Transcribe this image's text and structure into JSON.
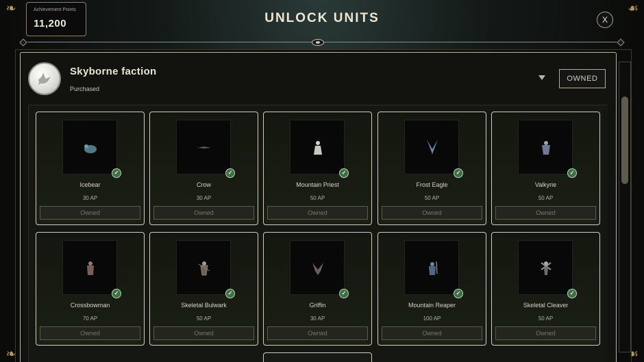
{
  "header": {
    "title": "UNLOCK UNITS",
    "close_label": "X",
    "achievement_points_label": "Achievement Points",
    "achievement_points_value": "11,200"
  },
  "faction": {
    "name": "Skyborne faction",
    "status": "Purchased",
    "owned_button": "OWNED",
    "emblem_icon": "dove-icon"
  },
  "units": [
    {
      "name": "Icebear",
      "cost": "30 AP",
      "button": "Owned"
    },
    {
      "name": "Crow",
      "cost": "30 AP",
      "button": "Owned"
    },
    {
      "name": "Mountain Priest",
      "cost": "50 AP",
      "button": "Owned"
    },
    {
      "name": "Frost Eagle",
      "cost": "50 AP",
      "button": "Owned"
    },
    {
      "name": "Valkyrie",
      "cost": "50 AP",
      "button": "Owned"
    },
    {
      "name": "Crossbowman",
      "cost": "70 AP",
      "button": "Owned"
    },
    {
      "name": "Skeletal Bulwark",
      "cost": "50 AP",
      "button": "Owned"
    },
    {
      "name": "Griffin",
      "cost": "30 AP",
      "button": "Owned"
    },
    {
      "name": "Mountain Reaper",
      "cost": "100 AP",
      "button": "Owned"
    },
    {
      "name": "Skeletal Cleaver",
      "cost": "50 AP",
      "button": "Owned"
    }
  ],
  "colors": {
    "accent_gold": "#b59a5a",
    "owned_check": "#3e6e44",
    "card_border": "#d3cebf"
  }
}
